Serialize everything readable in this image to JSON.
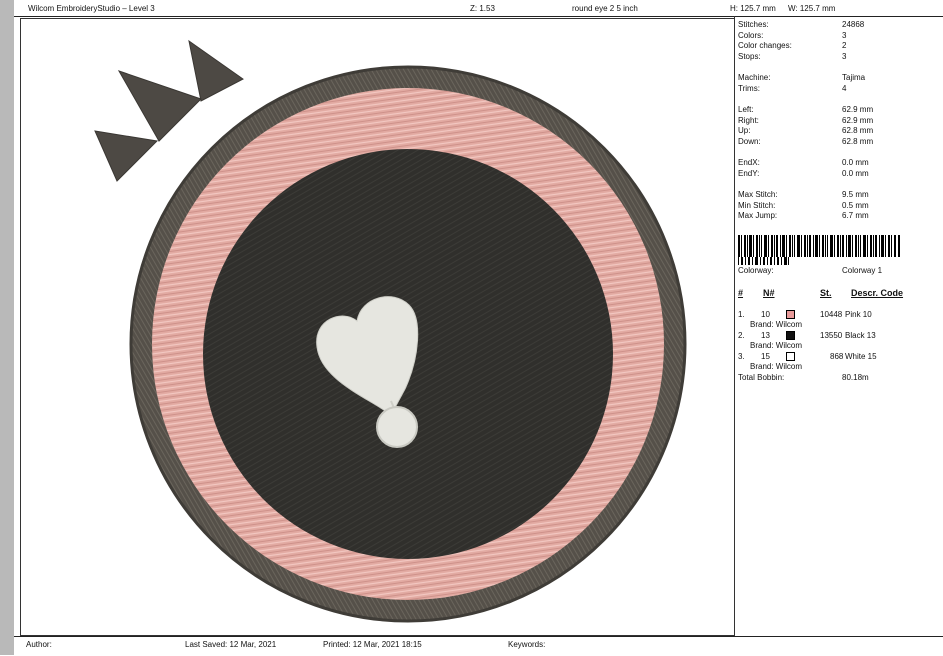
{
  "header": {
    "title": "Wilcom EmbroideryStudio – Level 3",
    "zoom": "Z: 1.53",
    "design_name": "round eye 2 5 inch",
    "height": "H: 125.7 mm",
    "width": "W: 125.7 mm"
  },
  "stats": [
    {
      "key": "Stitches:",
      "value": "24868"
    },
    {
      "key": "Colors:",
      "value": "3"
    },
    {
      "key": "Color changes:",
      "value": "2"
    },
    {
      "key": "Stops:",
      "value": "3"
    },
    {
      "key": "Machine:",
      "value": "Tajima"
    },
    {
      "key": "Trims:",
      "value": "4"
    },
    {
      "key": "Left:",
      "value": "62.9 mm"
    },
    {
      "key": "Right:",
      "value": "62.9 mm"
    },
    {
      "key": "Up:",
      "value": "62.8 mm"
    },
    {
      "key": "Down:",
      "value": "62.8 mm"
    },
    {
      "key": "EndX:",
      "value": "0.0 mm"
    },
    {
      "key": "EndY:",
      "value": "0.0 mm"
    },
    {
      "key": "Max Stitch:",
      "value": "9.5 mm"
    },
    {
      "key": "Min Stitch:",
      "value": "0.5 mm"
    },
    {
      "key": "Max Jump:",
      "value": "6.7 mm"
    }
  ],
  "colorway": {
    "label": "Colorway:",
    "value": "Colorway 1"
  },
  "color_table": {
    "headers": [
      "#",
      "N#",
      "St.",
      "Descr. Code"
    ],
    "rows": [
      {
        "idx": "1.",
        "n": "10",
        "swatch": "#e89a9a",
        "stitches": "10448",
        "descr": "Pink 10",
        "brand": "Brand: Wilcom"
      },
      {
        "idx": "2.",
        "n": "13",
        "swatch": "#111111",
        "stitches": "13550",
        "descr": "Black 13",
        "brand": "Brand: Wilcom"
      },
      {
        "idx": "3.",
        "n": "15",
        "swatch": "#ffffff",
        "stitches": "868",
        "descr": "White 15",
        "brand": "Brand: Wilcom"
      }
    ],
    "total_label": "Total Bobbin:",
    "total_value": "80.18m"
  },
  "footer": {
    "author": "Author:",
    "last_saved": "Last Saved: 12 Mar, 2021",
    "printed": "Printed: 12 Mar, 2021 18:15",
    "keywords": "Keywords:"
  },
  "colors": {
    "outer_ring": "#555049",
    "pink_ring": "#e2aaa2",
    "center": "#302f2c",
    "highlight": "#e6e6e0"
  }
}
